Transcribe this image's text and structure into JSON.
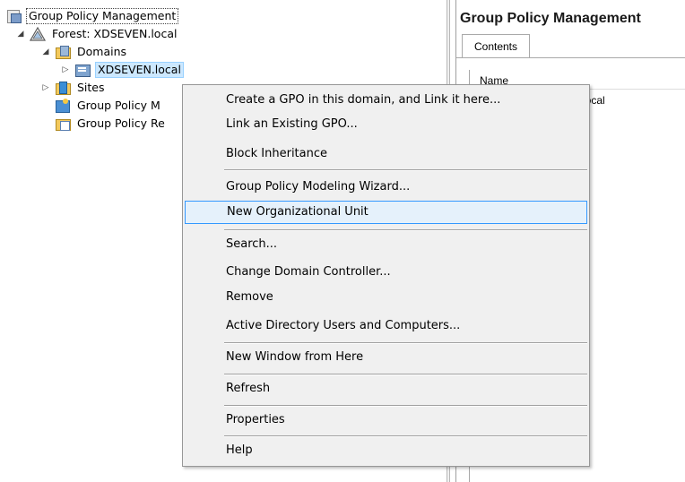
{
  "tree": {
    "items": [
      {
        "label": "Group Policy Management",
        "expander": "",
        "icon": "group-policy-management-icon"
      },
      {
        "label": "Forest: XDSEVEN.local",
        "expander": "◢",
        "icon": "forest-icon"
      },
      {
        "label": "Domains",
        "expander": "◢",
        "icon": "domains-folder-icon"
      },
      {
        "label": "XDSEVEN.local",
        "expander": "▷",
        "icon": "domain-icon"
      },
      {
        "label": "Sites",
        "expander": "▷",
        "icon": "sites-icon"
      },
      {
        "label": "Group Policy M",
        "expander": "",
        "icon": "group-policy-modeling-icon"
      },
      {
        "label": "Group Policy Re",
        "expander": "",
        "icon": "group-policy-results-icon"
      }
    ]
  },
  "right_pane": {
    "title": "Group Policy Management",
    "tab": "Contents",
    "column_header": "Name",
    "row_partial": "EN.local"
  },
  "context_menu": {
    "items": [
      "Create a GPO in this domain, and Link it here...",
      "Link an Existing GPO...",
      "Block Inheritance",
      "Group Policy Modeling Wizard...",
      "New Organizational Unit",
      "Search...",
      "Change Domain Controller...",
      "Remove",
      "Active Directory Users and Computers...",
      "New Window from Here",
      "Refresh",
      "Properties",
      "Help"
    ],
    "highlighted": "New Organizational Unit"
  },
  "colors": {
    "selection": "#cce8ff",
    "menu_background": "#f0f0f0",
    "menu_highlight": "#e5f1fb",
    "menu_highlight_border": "#3399ff"
  }
}
